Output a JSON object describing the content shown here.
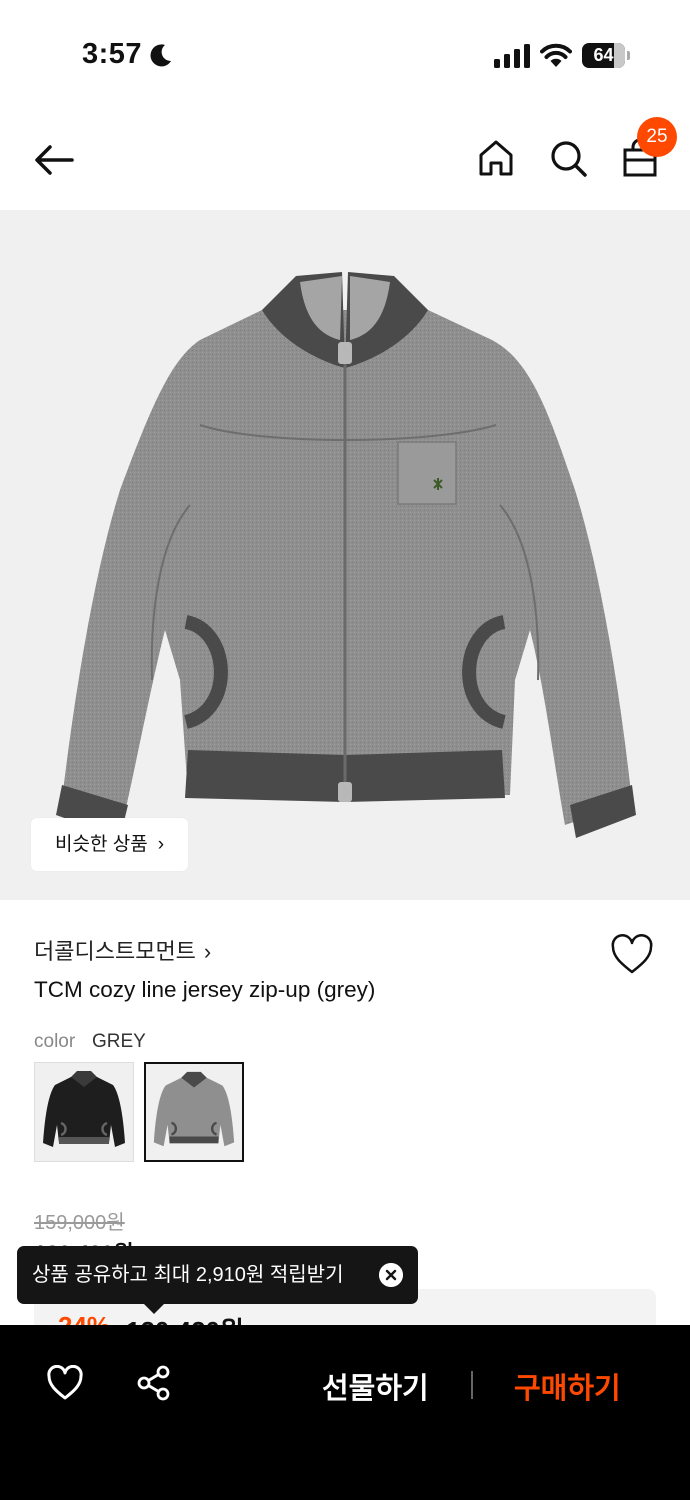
{
  "status_bar": {
    "time": "3:57",
    "battery": "64"
  },
  "nav": {
    "cart_count": "25"
  },
  "hero": {
    "similar_button_label": "비슷한 상품"
  },
  "product": {
    "brand": "더콜디스트모먼트",
    "name": "TCM cozy line jersey zip-up (grey)",
    "option_label": "color",
    "option_value": "GREY",
    "color_swatches": [
      "black",
      "grey"
    ],
    "selected_swatch": "grey",
    "original_price": "159,000원",
    "discount_pct": "24%",
    "discount_price": "120,420원"
  },
  "tooltip": {
    "text": "상품 공유하고 최대 2,910원 적립받기"
  },
  "bottom_bar": {
    "gift_label": "선물하기",
    "buy_label": "구매하기"
  },
  "colors": {
    "accent": "#ff4800",
    "jacket_grey": "#8c8c8c",
    "trim": "#4a4a4a"
  },
  "icons": [
    "moon-icon",
    "signal-icon",
    "wifi-icon",
    "battery-icon",
    "back-arrow-icon",
    "home-icon",
    "search-icon",
    "shopping-bag-icon",
    "heart-icon",
    "share-icon",
    "close-icon",
    "chevron-right-icon"
  ]
}
